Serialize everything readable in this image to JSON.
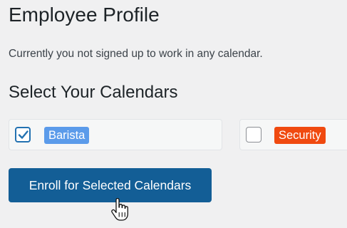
{
  "page": {
    "title": "Employee Profile",
    "notice": "Currently you not signed up to work in any calendar.",
    "section_title": "Select Your Calendars"
  },
  "calendars": [
    {
      "label": "Barista",
      "checked": true,
      "color": "#5b9bea",
      "text_color": "#ffffff"
    },
    {
      "label": "Security",
      "checked": false,
      "color": "#f04a10",
      "text_color": "#ffffff"
    }
  ],
  "actions": {
    "enroll_label": "Enroll for Selected Calendars"
  },
  "colors": {
    "background": "#f0f0f1",
    "primary_button": "#135e96",
    "checkbox_accent": "#2271b1"
  },
  "cursor": "hand-pointer-icon"
}
